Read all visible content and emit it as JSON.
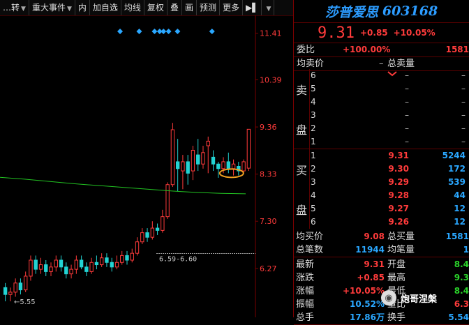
{
  "toolbar": {
    "items": [
      {
        "label": "…转",
        "dropdown": true
      },
      {
        "label": "重大事件",
        "dropdown": true
      },
      {
        "label": "内",
        "dropdown": false
      },
      {
        "label": "加自选",
        "dropdown": false
      },
      {
        "label": "均线",
        "dropdown": false
      },
      {
        "label": "复权",
        "dropdown": false
      },
      {
        "label": "叠",
        "dropdown": false
      },
      {
        "label": "画",
        "dropdown": false
      },
      {
        "label": "预测",
        "dropdown": false
      },
      {
        "label": "更多",
        "dropdown": false
      }
    ],
    "pin_icon": "pin-icon"
  },
  "chart_data": {
    "type": "candlestick",
    "y_ticks": [
      "11.41",
      "10.39",
      "9.36",
      "8.33",
      "7.30",
      "6.27"
    ],
    "ylim": [
      5.2,
      11.8
    ],
    "annotations": {
      "low_label": "←5.55",
      "gap_label": "6.59-6.60"
    },
    "colors": {
      "up": "#ff3b3b",
      "down": "#22d3d3",
      "ma": "#22c422",
      "marker": "#2aa7ff"
    },
    "candles": [
      {
        "o": 5.85,
        "c": 5.7,
        "h": 5.95,
        "l": 5.55
      },
      {
        "o": 5.7,
        "c": 5.75,
        "h": 5.85,
        "l": 5.55
      },
      {
        "o": 5.75,
        "c": 5.95,
        "h": 6.05,
        "l": 5.65
      },
      {
        "o": 5.95,
        "c": 5.8,
        "h": 6.05,
        "l": 5.7
      },
      {
        "o": 5.8,
        "c": 6.1,
        "h": 6.2,
        "l": 5.75
      },
      {
        "o": 6.1,
        "c": 6.45,
        "h": 6.55,
        "l": 6.0
      },
      {
        "o": 6.45,
        "c": 6.25,
        "h": 6.55,
        "l": 6.15
      },
      {
        "o": 6.25,
        "c": 6.35,
        "h": 6.5,
        "l": 6.15
      },
      {
        "o": 6.35,
        "c": 6.2,
        "h": 6.45,
        "l": 6.1
      },
      {
        "o": 6.2,
        "c": 6.3,
        "h": 6.4,
        "l": 6.1
      },
      {
        "o": 6.3,
        "c": 6.45,
        "h": 6.55,
        "l": 6.2
      },
      {
        "o": 6.45,
        "c": 6.3,
        "h": 6.55,
        "l": 6.2
      },
      {
        "o": 6.3,
        "c": 6.15,
        "h": 6.4,
        "l": 6.05
      },
      {
        "o": 6.15,
        "c": 6.25,
        "h": 6.35,
        "l": 6.05
      },
      {
        "o": 6.25,
        "c": 6.45,
        "h": 6.55,
        "l": 6.15
      },
      {
        "o": 6.45,
        "c": 6.3,
        "h": 6.55,
        "l": 6.25
      },
      {
        "o": 6.3,
        "c": 6.2,
        "h": 6.4,
        "l": 6.1
      },
      {
        "o": 6.2,
        "c": 6.4,
        "h": 6.5,
        "l": 6.15
      },
      {
        "o": 6.4,
        "c": 6.35,
        "h": 6.55,
        "l": 6.25
      },
      {
        "o": 6.35,
        "c": 6.5,
        "h": 6.6,
        "l": 6.3
      },
      {
        "o": 6.5,
        "c": 6.4,
        "h": 6.6,
        "l": 6.3
      },
      {
        "o": 6.4,
        "c": 6.3,
        "h": 6.5,
        "l": 6.2
      },
      {
        "o": 6.3,
        "c": 6.4,
        "h": 6.55,
        "l": 6.25
      },
      {
        "o": 6.4,
        "c": 6.55,
        "h": 6.65,
        "l": 6.35
      },
      {
        "o": 6.55,
        "c": 6.45,
        "h": 6.65,
        "l": 6.35
      },
      {
        "o": 6.45,
        "c": 6.6,
        "h": 6.7,
        "l": 6.4
      },
      {
        "o": 6.6,
        "c": 6.85,
        "h": 6.95,
        "l": 6.55
      },
      {
        "o": 6.85,
        "c": 7.05,
        "h": 7.15,
        "l": 6.8
      },
      {
        "o": 7.05,
        "c": 6.95,
        "h": 7.15,
        "l": 6.85
      },
      {
        "o": 6.95,
        "c": 7.15,
        "h": 7.3,
        "l": 6.9
      },
      {
        "o": 7.15,
        "c": 7.1,
        "h": 7.25,
        "l": 7.0
      },
      {
        "o": 7.1,
        "c": 7.4,
        "h": 7.55,
        "l": 7.05
      },
      {
        "o": 7.4,
        "c": 8.1,
        "h": 8.15,
        "l": 7.35
      },
      {
        "o": 8.1,
        "c": 9.3,
        "h": 9.45,
        "l": 8.05
      },
      {
        "o": 8.6,
        "c": 8.45,
        "h": 9.1,
        "l": 7.95
      },
      {
        "o": 8.4,
        "c": 8.6,
        "h": 8.75,
        "l": 8.0
      },
      {
        "o": 8.6,
        "c": 8.35,
        "h": 8.75,
        "l": 8.1
      },
      {
        "o": 8.4,
        "c": 8.85,
        "h": 8.95,
        "l": 8.2
      },
      {
        "o": 8.75,
        "c": 8.55,
        "h": 9.1,
        "l": 8.4
      },
      {
        "o": 8.55,
        "c": 8.8,
        "h": 8.95,
        "l": 8.45
      },
      {
        "o": 8.95,
        "c": 9.05,
        "h": 9.15,
        "l": 8.35
      },
      {
        "o": 8.7,
        "c": 8.55,
        "h": 8.85,
        "l": 8.4
      },
      {
        "o": 8.55,
        "c": 8.45,
        "h": 8.6,
        "l": 8.25
      },
      {
        "o": 8.45,
        "c": 8.6,
        "h": 8.7,
        "l": 8.35
      },
      {
        "o": 8.6,
        "c": 8.45,
        "h": 8.8,
        "l": 8.35
      },
      {
        "o": 8.45,
        "c": 8.55,
        "h": 8.65,
        "l": 8.3
      },
      {
        "o": 8.5,
        "c": 8.4,
        "h": 8.6,
        "l": 8.3
      },
      {
        "o": 8.4,
        "c": 8.6,
        "h": 8.65,
        "l": 8.35
      },
      {
        "o": 8.46,
        "c": 9.31,
        "h": 9.31,
        "l": 8.4
      }
    ],
    "ma_line": [
      [
        0,
        8.26
      ],
      [
        0.1,
        8.22
      ],
      [
        0.2,
        8.17
      ],
      [
        0.3,
        8.12
      ],
      [
        0.4,
        8.08
      ],
      [
        0.5,
        8.04
      ],
      [
        0.6,
        8.0
      ],
      [
        0.7,
        7.96
      ],
      [
        0.8,
        7.93
      ],
      [
        0.9,
        7.91
      ],
      [
        1.0,
        7.9
      ]
    ],
    "markers": [
      47,
      54.5,
      60.5,
      62.5,
      64,
      66,
      69.5,
      83
    ]
  },
  "quote": {
    "name": "莎普爱思",
    "code": "603168",
    "price": "9.31",
    "change": "+0.85",
    "change_pct": "+10.05%"
  },
  "committee": {
    "label": "委比",
    "ratio": "+100.00%",
    "diff": "1581"
  },
  "avg_sell": {
    "label": "均卖价",
    "value": "–",
    "total_label": "总卖量"
  },
  "sell_side_label": [
    "卖",
    "盘"
  ],
  "buy_side_label": [
    "买",
    "盘"
  ],
  "asks": [
    {
      "n": "6",
      "p": "–",
      "v": "–"
    },
    {
      "n": "5",
      "p": "–",
      "v": "–"
    },
    {
      "n": "4",
      "p": "–",
      "v": "–"
    },
    {
      "n": "3",
      "p": "–",
      "v": "–"
    },
    {
      "n": "2",
      "p": "–",
      "v": "–"
    },
    {
      "n": "1",
      "p": "–",
      "v": "–"
    }
  ],
  "bids": [
    {
      "n": "1",
      "p": "9.31",
      "v": "5244"
    },
    {
      "n": "2",
      "p": "9.30",
      "v": "172"
    },
    {
      "n": "3",
      "p": "9.29",
      "v": "539"
    },
    {
      "n": "4",
      "p": "9.28",
      "v": "44"
    },
    {
      "n": "5",
      "p": "9.27",
      "v": "12"
    },
    {
      "n": "6",
      "p": "9.26",
      "v": "12"
    }
  ],
  "stats_a": [
    {
      "l1": "均买价",
      "v1": "9.08",
      "l2": "总买量",
      "v2": "1581"
    },
    {
      "l1": "总笔数",
      "v1": "11944",
      "l2": "均笔量",
      "v2": "1"
    }
  ],
  "stats_b": [
    {
      "l1": "最新",
      "v1": "9.31",
      "l2": "开盘",
      "v2": "8.4"
    },
    {
      "l1": "涨跌",
      "v1": "+0.85",
      "l2": "最高",
      "v2": "9.3"
    },
    {
      "l1": "涨幅",
      "v1": "+10.05%",
      "l2": "最低",
      "v2": "8.4"
    },
    {
      "l1": "振幅",
      "v1": "10.52%",
      "l2": "量比",
      "v2": "6.3"
    },
    {
      "l1": "总手",
      "v1": "17.86万",
      "l2": "换手",
      "v2": "5.54"
    }
  ],
  "watermark": {
    "text": "炮哥涅槃",
    "icon": "wechat-icon"
  }
}
